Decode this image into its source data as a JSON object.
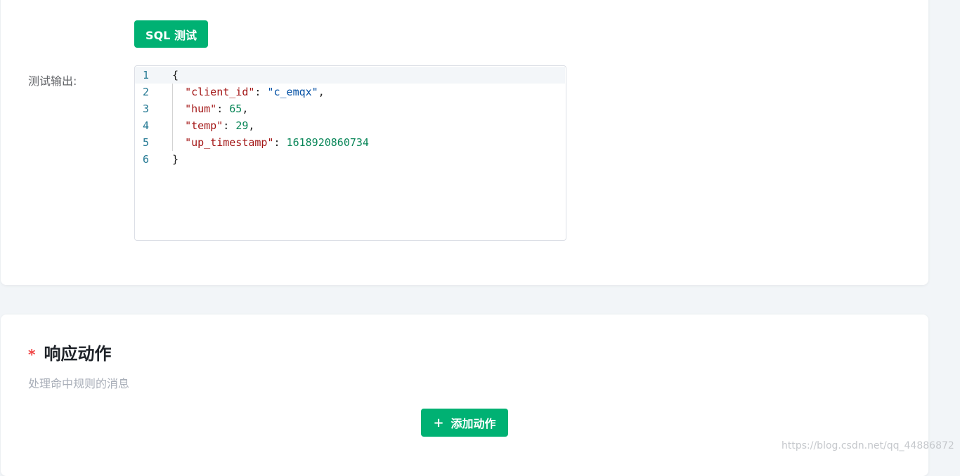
{
  "sql_test": {
    "button_label": "SQL 测试"
  },
  "test_output": {
    "label": "测试输出:",
    "line_numbers": [
      "1",
      "2",
      "3",
      "4",
      "5",
      "6"
    ],
    "open_brace": "{",
    "close_brace": "}",
    "fields": [
      {
        "key": "\"client_id\"",
        "value": "\"c_emqx\"",
        "type": "string",
        "comma": ","
      },
      {
        "key": "\"hum\"",
        "value": "65",
        "type": "number",
        "comma": ","
      },
      {
        "key": "\"temp\"",
        "value": "29",
        "type": "number",
        "comma": ","
      },
      {
        "key": "\"up_timestamp\"",
        "value": "1618920860734",
        "type": "number",
        "comma": ""
      }
    ]
  },
  "response_actions": {
    "required_mark": "*",
    "title": "响应动作",
    "description": "处理命中规则的消息",
    "add_button": {
      "icon": "plus-icon",
      "icon_glyph": "+",
      "label": "添加动作"
    }
  },
  "watermark": "https://blog.csdn.net/qq_44886872",
  "colors": {
    "accent": "#00b173",
    "required": "#f04848",
    "json_key": "#a31515",
    "json_string": "#0451a5",
    "json_number": "#098658",
    "line_number": "#237893"
  }
}
